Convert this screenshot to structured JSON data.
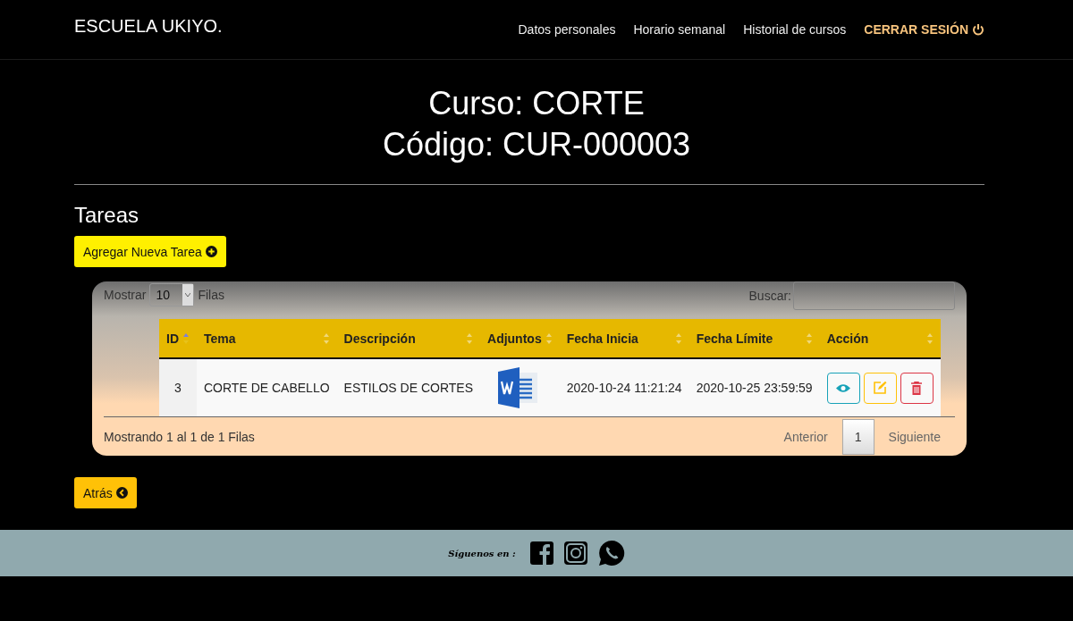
{
  "navbar": {
    "brand": "ESCUELA UKIYO.",
    "links": [
      {
        "label": "Datos personales",
        "kind": "plain"
      },
      {
        "label": "Horario semanal",
        "kind": "plain"
      },
      {
        "label": "Historial de cursos",
        "kind": "plain"
      },
      {
        "label": "CERRAR SESIÓN",
        "kind": "logout"
      }
    ]
  },
  "heading": {
    "course": "Curso: CORTE",
    "code": "Código: CUR-000003"
  },
  "section_title": "Tareas",
  "add_button": "Agregar Nueva Tarea",
  "table_panel": {
    "length_label_before": "Mostrar",
    "length_value": "10",
    "length_label_after": "Filas",
    "search_label": "Buscar:",
    "columns": [
      {
        "label": "ID",
        "sorted": true
      },
      {
        "label": "Tema",
        "sorted": false
      },
      {
        "label": "Descripción",
        "sorted": false
      },
      {
        "label": "Adjuntos",
        "sorted": false
      },
      {
        "label": "Fecha Inicia",
        "sorted": false
      },
      {
        "label": "Fecha Límite",
        "sorted": false
      },
      {
        "label": "Acción",
        "sorted": false
      }
    ],
    "rows": [
      {
        "id": "3",
        "tema": "CORTE DE CABELLO",
        "descripcion": "ESTILOS DE CORTES",
        "fecha_inicia": "2020-10-24 11:21:24",
        "fecha_limite": "2020-10-25 23:59:59"
      }
    ],
    "info": "Mostrando 1 al 1 de 1 Filas",
    "pagination": {
      "previous": "Anterior",
      "pages": [
        {
          "label": "1",
          "selected": true
        }
      ],
      "next": "Siguiente"
    }
  },
  "back_button": "Atrás",
  "footer": {
    "follow_text": "Síguenos en :"
  }
}
